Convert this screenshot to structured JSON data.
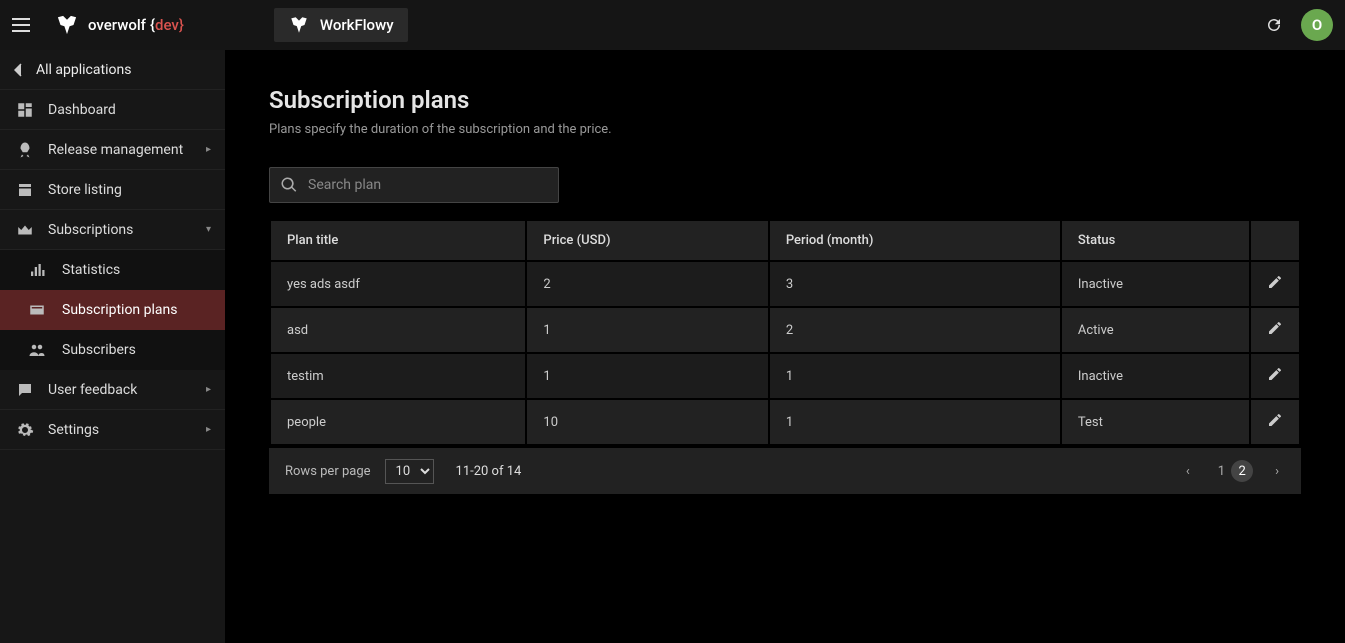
{
  "brand": {
    "name": "overwolf",
    "suffix": "dev"
  },
  "appChip": {
    "name": "WorkFlowy"
  },
  "avatar": {
    "initial": "O"
  },
  "sidebar": {
    "back": "All applications",
    "items": [
      {
        "label": "Dashboard"
      },
      {
        "label": "Release management"
      },
      {
        "label": "Store listing"
      },
      {
        "label": "Subscriptions"
      },
      {
        "label": "User feedback"
      },
      {
        "label": "Settings"
      }
    ],
    "subs": {
      "subscriptions": [
        {
          "label": "Statistics"
        },
        {
          "label": "Subscription plans"
        },
        {
          "label": "Subscribers"
        }
      ]
    }
  },
  "page": {
    "title": "Subscription plans",
    "subtitle": "Plans specify the duration of the subscription and the price."
  },
  "search": {
    "placeholder": "Search plan"
  },
  "table": {
    "headers": [
      "Plan title",
      "Price (USD)",
      "Period (month)",
      "Status"
    ],
    "rows": [
      {
        "title": "yes ads asdf",
        "price": "2",
        "period": "3",
        "status": "Inactive"
      },
      {
        "title": "asd",
        "price": "1",
        "period": "2",
        "status": "Active"
      },
      {
        "title": "testim",
        "price": "1",
        "period": "1",
        "status": "Inactive"
      },
      {
        "title": "people",
        "price": "10",
        "period": "1",
        "status": "Test"
      }
    ]
  },
  "pager": {
    "rowsLabel": "Rows per page",
    "perPage": "10",
    "range": "11-20 of 14",
    "pages": [
      "1",
      "2"
    ],
    "currentPage": "2"
  }
}
